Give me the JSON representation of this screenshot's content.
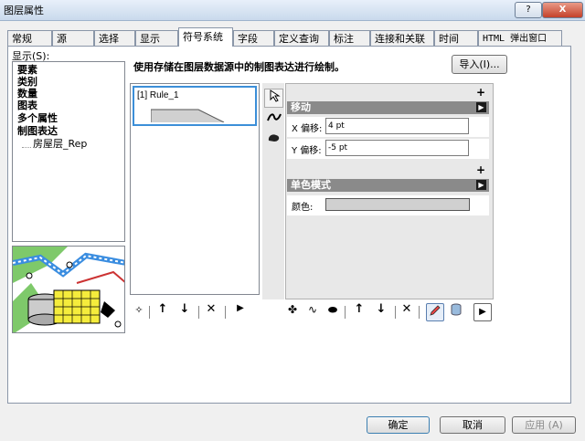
{
  "window": {
    "title": "图层属性",
    "help_label": "?",
    "close_label": "X"
  },
  "tabs": [
    "常规",
    "源",
    "选择",
    "显示",
    "符号系统",
    "字段",
    "定义查询",
    "标注",
    "连接和关联",
    "时间",
    "HTML 弹出窗口"
  ],
  "active_tab": "符号系统",
  "show": {
    "label": "显示(S):",
    "items": [
      "要素",
      "类别",
      "数量",
      "图表",
      "多个属性",
      "制图表达"
    ],
    "child_item": "房屋层_Rep"
  },
  "description": "使用存储在图层数据源中的制图表达进行绘制。",
  "import_button": "导入(I)...",
  "rules": [
    {
      "label": "[1] Rule_1"
    }
  ],
  "layer_tools": [
    "select-layer-icon",
    "line-layer-icon",
    "polygon-layer-icon"
  ],
  "move_section": {
    "title": "移动",
    "x_label": "X 偏移:",
    "x_value": "4 pt",
    "y_label": "Y 偏移:",
    "y_value": "-5 pt",
    "expand_label": "+"
  },
  "color_section": {
    "title": "单色模式",
    "color_label": "颜色:",
    "color": "#d0d0d0",
    "expand_label": "+"
  },
  "rule_toolbar": [
    "add-icon",
    "up-arrow-icon",
    "down-arrow-icon",
    "delete-icon",
    "more-arrow-icon"
  ],
  "prop_toolbar": [
    "add-point-layer-icon",
    "add-line-layer-icon",
    "add-polygon-layer-icon",
    "up-arrow-icon",
    "down-arrow-icon",
    "delete-icon",
    "pencil-icon",
    "cylinder-icon",
    "more-arrow-icon"
  ],
  "footer": {
    "ok": "确定",
    "cancel": "取消",
    "apply": "应用 (A)"
  },
  "colors": {
    "accent": "#3c8fd8",
    "section_header": "#8a8a8a",
    "close": "#c4412a"
  }
}
